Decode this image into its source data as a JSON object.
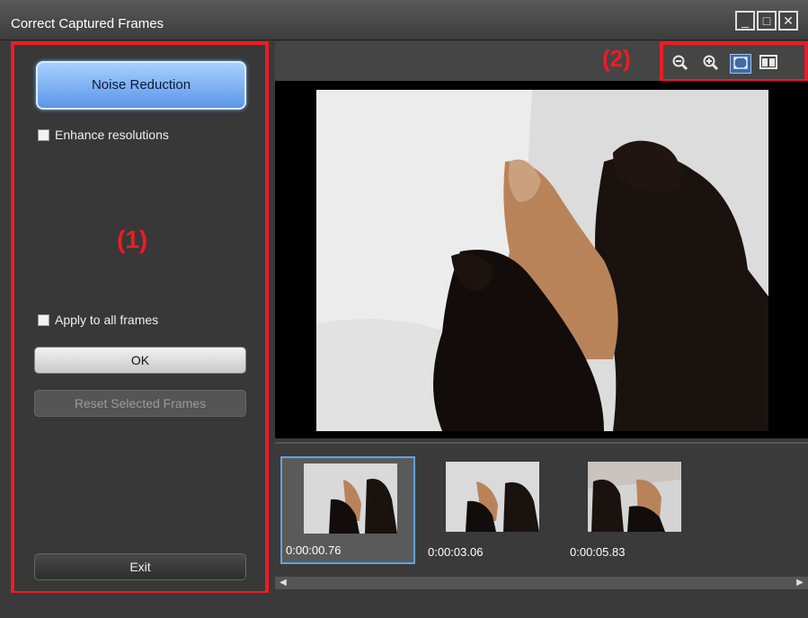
{
  "window": {
    "title": "Correct Captured Frames",
    "minimize_glyph": "_",
    "maximize_glyph": "□",
    "close_glyph": "✕"
  },
  "panel": {
    "mode_button": "Noise Reduction",
    "enhance_label": "Enhance resolutions",
    "marker": "(1)",
    "apply_all_label": "Apply to all frames",
    "ok_label": "OK",
    "reset_label": "Reset Selected Frames",
    "exit_label": "Exit"
  },
  "toolbar": {
    "marker": "(2)",
    "icons": [
      "zoom-out-icon",
      "zoom-in-icon",
      "full-screen-icon",
      "compare-view-icon"
    ]
  },
  "frames": [
    {
      "time": "0:00:00.76",
      "selected": true
    },
    {
      "time": "0:00:03.06",
      "selected": false
    },
    {
      "time": "0:00:05.83",
      "selected": false
    }
  ],
  "colors": {
    "annotation_red": "#ee1c25",
    "accent_blue": "#5b95e8",
    "selection_blue": "#5aa5e8"
  }
}
